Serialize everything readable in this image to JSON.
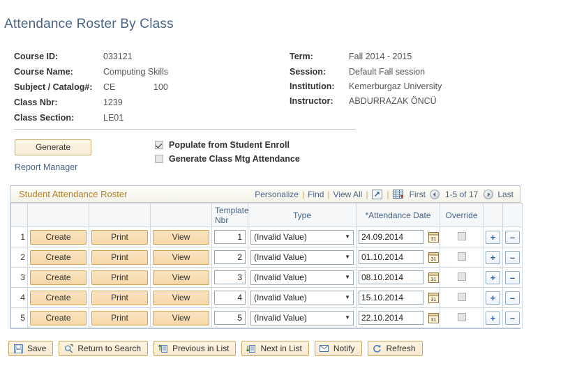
{
  "page": {
    "title": "Attendance Roster By Class"
  },
  "header": {
    "left": [
      {
        "label": "Course ID:",
        "value": "033121",
        "value2": ""
      },
      {
        "label": "Course Name:",
        "value": "Computing Skills",
        "value2": ""
      },
      {
        "label": "Subject / Catalog#:",
        "value": "CE",
        "value2": "100"
      },
      {
        "label": "Class Nbr:",
        "value": "1239",
        "value2": ""
      },
      {
        "label": "Class Section:",
        "value": "LE01",
        "value2": ""
      }
    ],
    "right": [
      {
        "label": "Term:",
        "value": "Fall 2014 - 2015"
      },
      {
        "label": "Session:",
        "value": "Default Fall session"
      },
      {
        "label": "Institution:",
        "value": "Kemerburgaz University"
      },
      {
        "label": "Instructor:",
        "value": "ABDURRAZAK ÖNCÜ"
      }
    ]
  },
  "actions": {
    "generate_label": "Generate",
    "report_manager_label": "Report Manager",
    "checkboxes": [
      {
        "label": "Populate from Student Enroll",
        "checked": true
      },
      {
        "label": "Generate Class Mtg Attendance",
        "checked": false
      }
    ]
  },
  "grid": {
    "title": "Student Attendance Roster",
    "nav": {
      "personalize": "Personalize",
      "find": "Find",
      "view_all": "View All",
      "sep": "|",
      "zoom_icon": "expand-grid-icon",
      "download_icon": "download-spreadsheet-icon",
      "first": "First",
      "range": "1-5 of 17",
      "last": "Last"
    },
    "columns": [
      "",
      "",
      "",
      "",
      "Template Nbr",
      "Type",
      "*Attendance Date",
      "Override",
      "",
      ""
    ],
    "rows": [
      {
        "num": "1",
        "create": "Create",
        "print": "Print",
        "view": "View",
        "template_nbr": "1",
        "type": "(Invalid Value)",
        "attendance_date": "24.09.2014",
        "override_checked": false,
        "add": "+",
        "remove": "–"
      },
      {
        "num": "2",
        "create": "Create",
        "print": "Print",
        "view": "View",
        "template_nbr": "2",
        "type": "(Invalid Value)",
        "attendance_date": "01.10.2014",
        "override_checked": false,
        "add": "+",
        "remove": "–"
      },
      {
        "num": "3",
        "create": "Create",
        "print": "Print",
        "view": "View",
        "template_nbr": "3",
        "type": "(Invalid Value)",
        "attendance_date": "08.10.2014",
        "override_checked": false,
        "add": "+",
        "remove": "–"
      },
      {
        "num": "4",
        "create": "Create",
        "print": "Print",
        "view": "View",
        "template_nbr": "4",
        "type": "(Invalid Value)",
        "attendance_date": "15.10.2014",
        "override_checked": false,
        "add": "+",
        "remove": "–"
      },
      {
        "num": "5",
        "create": "Create",
        "print": "Print",
        "view": "View",
        "template_nbr": "5",
        "type": "(Invalid Value)",
        "attendance_date": "22.10.2014",
        "override_checked": false,
        "add": "+",
        "remove": "–"
      }
    ]
  },
  "toolbar": [
    {
      "label": "Save",
      "icon": "save-disk-icon"
    },
    {
      "label": "Return to Search",
      "icon": "search-return-icon"
    },
    {
      "label": "Previous in List",
      "icon": "previous-in-list-icon"
    },
    {
      "label": "Next in List",
      "icon": "next-in-list-icon"
    },
    {
      "label": "Notify",
      "icon": "notify-envelope-icon"
    },
    {
      "label": "Refresh",
      "icon": "refresh-icon"
    }
  ],
  "colors": {
    "title_blue": "#4a6484",
    "grid_title_gold": "#b07f2a",
    "button_gold": "#f6d7a8",
    "link_blue": "#4a6484"
  }
}
